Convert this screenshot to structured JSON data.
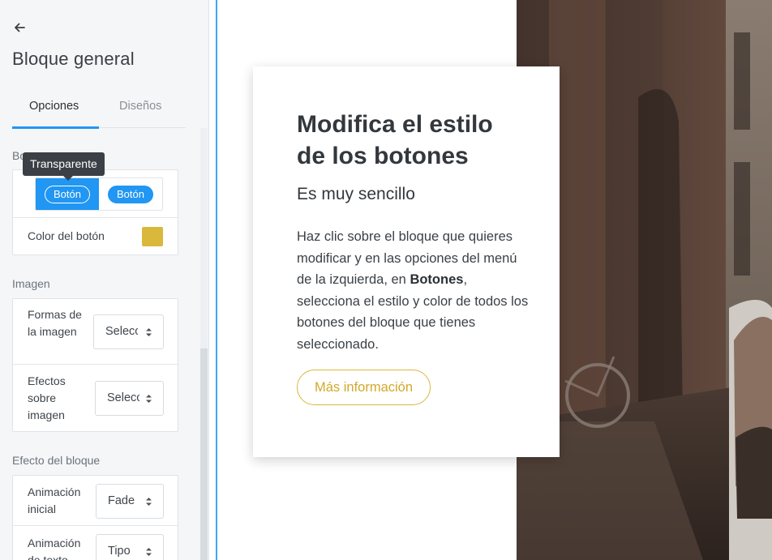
{
  "sidebar": {
    "back_icon": "arrow-left-icon",
    "title": "Bloque general",
    "tabs": [
      {
        "label": "Opciones",
        "active": true
      },
      {
        "label": "Diseños",
        "active": false
      }
    ],
    "buttons_section": {
      "label_partial": "Bo",
      "tooltip": "Transparente",
      "style_options": [
        {
          "label": "Botón",
          "style": "outline",
          "selected": true
        },
        {
          "label": "Botón",
          "style": "solid",
          "selected": false
        }
      ],
      "color_label": "Color del botón",
      "color_value": "#d9b83c"
    },
    "image_section": {
      "label": "Imagen",
      "rows": [
        {
          "label": "Formas de la imagen",
          "select_value": "Seleccionar"
        },
        {
          "label": "Efectos sobre imagen",
          "select_value": "Seleccionar"
        }
      ]
    },
    "block_effect_section": {
      "label": "Efecto del bloque",
      "rows": [
        {
          "label": "Animación inicial",
          "select_value": "Fade"
        },
        {
          "label": "Animación de texto",
          "select_value": "Tipo"
        }
      ]
    }
  },
  "preview": {
    "card": {
      "title": "Modifica el estilo de los botones",
      "subtitle": "Es muy sencillo",
      "body_before": "Haz clic sobre el bloque que quieres modificar y en las opciones del menú de la izquierda, en ",
      "body_bold": "Botones",
      "body_after": ", selecciona el estilo y color de todos los botones del bloque que tienes seleccionado.",
      "cta_label": "Más información"
    },
    "accent_color": "#d9b83c",
    "selection_color": "#2196f3"
  }
}
